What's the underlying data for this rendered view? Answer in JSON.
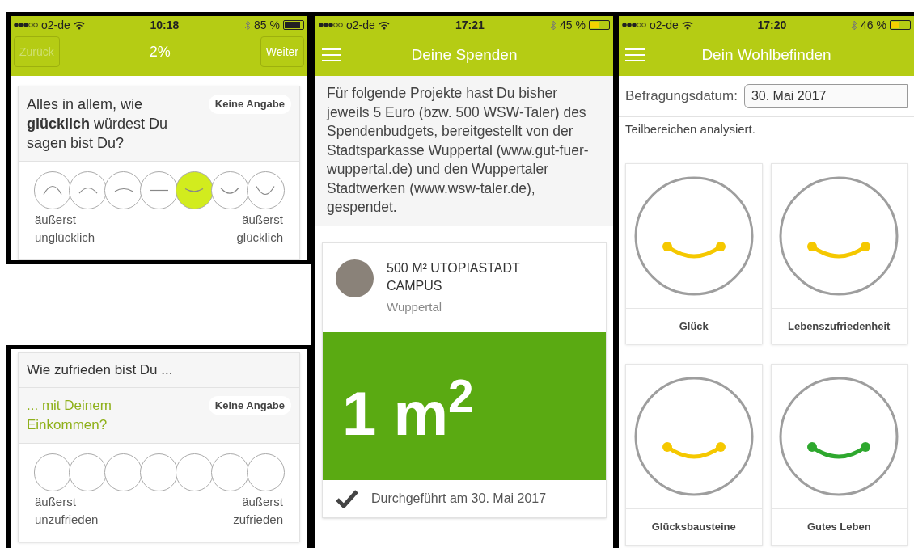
{
  "survey_screen": {
    "status_bar": {
      "carrier": "o2-de",
      "time": "10:18",
      "battery": "85 %",
      "level": 0.85
    },
    "nav": {
      "back": {
        "label": "Zurück",
        "disabled": true
      },
      "progress": "2%",
      "next": {
        "label": "Weiter",
        "disabled": false
      }
    },
    "question": {
      "text": "Alles in allem, wie **glücklich** würdest Du sagen bist Du?",
      "no_answer": "Keine Angabe",
      "faces": true,
      "options": [
        {
          "selected": false
        },
        {
          "selected": false
        },
        {
          "selected": false
        },
        {
          "selected": false
        },
        {
          "selected": true
        },
        {
          "selected": false
        },
        {
          "selected": false
        }
      ],
      "low_label": "äußerst unglücklich",
      "high_label": "äußerst glücklich"
    }
  },
  "satisfaction_screen": {
    "heading": "Wie zufrieden bist Du ...",
    "question": {
      "text": "... mit Deinem Einkommen?",
      "no_answer": "Keine Angabe",
      "faces": false,
      "options": [
        {
          "selected": false
        },
        {
          "selected": false
        },
        {
          "selected": false
        },
        {
          "selected": false
        },
        {
          "selected": false
        },
        {
          "selected": false
        },
        {
          "selected": false
        }
      ],
      "low_label": "äußerst unzufrieden",
      "high_label": "äußerst zufrieden"
    }
  },
  "donations_screen": {
    "status_bar": {
      "carrier": "o2-de",
      "time": "17:21",
      "battery": "45 %",
      "level": 0.45
    },
    "title": "Deine Spenden",
    "intro": "Für folgende Projekte hast Du bisher jeweils 5 Euro (bzw. 500 WSW-Taler) des Spendenbudgets, bereitgestellt von der Stadtsparkasse Wuppertal (www.gut-fuer-wuppertal.de) und den Wuppertaler Stadtwerken (www.wsw-taler.de), gespendet.",
    "project": {
      "name": "500 M² UTOPIASTADT CAMPUS",
      "place": "Wuppertal",
      "amount": "1 m$^{2}$",
      "done": true,
      "status": "Durchgeführt am 30. Mai 2017"
    }
  },
  "wellbeing_screen": {
    "status_bar": {
      "carrier": "o2-de",
      "time": "17:20",
      "battery": "46 %",
      "level": 0.46
    },
    "title": "Dein Wohlbefinden",
    "date_label": "Befragungsdatum:",
    "date": "30. Mai 2017",
    "text": "Teilbereichen analysiert.",
    "areas": [
      {
        "label": "Glück",
        "color": "#f5c800"
      },
      {
        "label": "Lebenszufriedenheit",
        "color": "#f5c800"
      },
      {
        "label": "Glücksbausteine",
        "color": "#f5c800"
      },
      {
        "label": "Gutes Leben",
        "color": "#2ea82e"
      }
    ]
  }
}
